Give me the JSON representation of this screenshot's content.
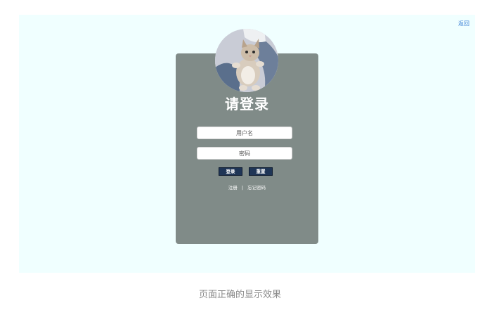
{
  "header": {
    "back_label": "返回"
  },
  "login": {
    "title": "请登录",
    "username_placeholder": "用户名",
    "password_placeholder": "密码",
    "login_button": "登录",
    "reset_button": "重置",
    "register_link": "注册",
    "separator": "|",
    "forgot_link": "忘记密码"
  },
  "caption": "页面正确的显示效果",
  "colors": {
    "page_background": "#f0ffff",
    "card_background": "#808b88",
    "button_background": "#1f3556",
    "link_color": "#3a7fd5"
  },
  "icons": {
    "avatar": "kitten-photo"
  }
}
